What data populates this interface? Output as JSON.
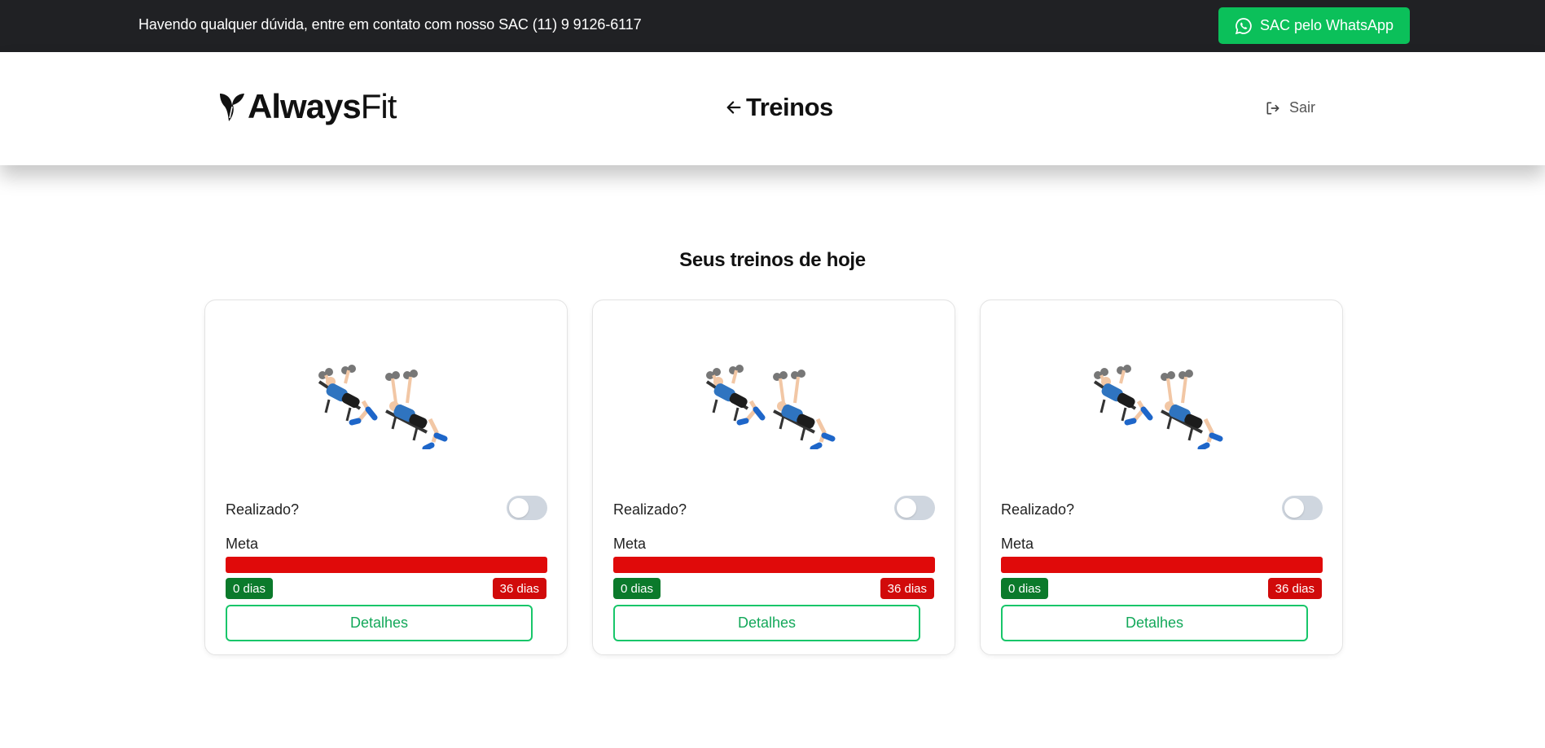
{
  "topbar": {
    "notice": "Havendo qualquer dúvida, entre em contato com nosso SAC (11) 9 9126-6117",
    "whatsapp_label": "SAC pelo WhatsApp",
    "whatsapp_icon": "whatsapp-icon"
  },
  "header": {
    "logo_strong": "Always",
    "logo_light": "Fit",
    "title": "Treinos",
    "back_icon": "arrow-left-icon",
    "logout_label": "Sair",
    "logout_icon": "logout-icon"
  },
  "main": {
    "section_title": "Seus treinos de hoje",
    "workouts": [
      {
        "done_label": "Realizado?",
        "done": false,
        "goal_label": "Meta",
        "goal_progress": 0,
        "start_badge": "0 dias",
        "end_badge": "36 dias",
        "details_label": "Detalhes",
        "image": "dumbbell-bench-press-illustration"
      },
      {
        "done_label": "Realizado?",
        "done": false,
        "goal_label": "Meta",
        "goal_progress": 0,
        "start_badge": "0 dias",
        "end_badge": "36 dias",
        "details_label": "Detalhes",
        "image": "dumbbell-bench-press-illustration"
      },
      {
        "done_label": "Realizado?",
        "done": false,
        "goal_label": "Meta",
        "goal_progress": 0,
        "start_badge": "0 dias",
        "end_badge": "36 dias",
        "details_label": "Detalhes",
        "image": "dumbbell-bench-press-illustration"
      }
    ]
  },
  "colors": {
    "topbar_bg": "#202124",
    "whatsapp_green": "#0bc05a",
    "progress_red": "#e00a0a",
    "badge_green": "#0b7a2b",
    "badge_red": "#d10a0a",
    "details_border": "#18c66a"
  }
}
